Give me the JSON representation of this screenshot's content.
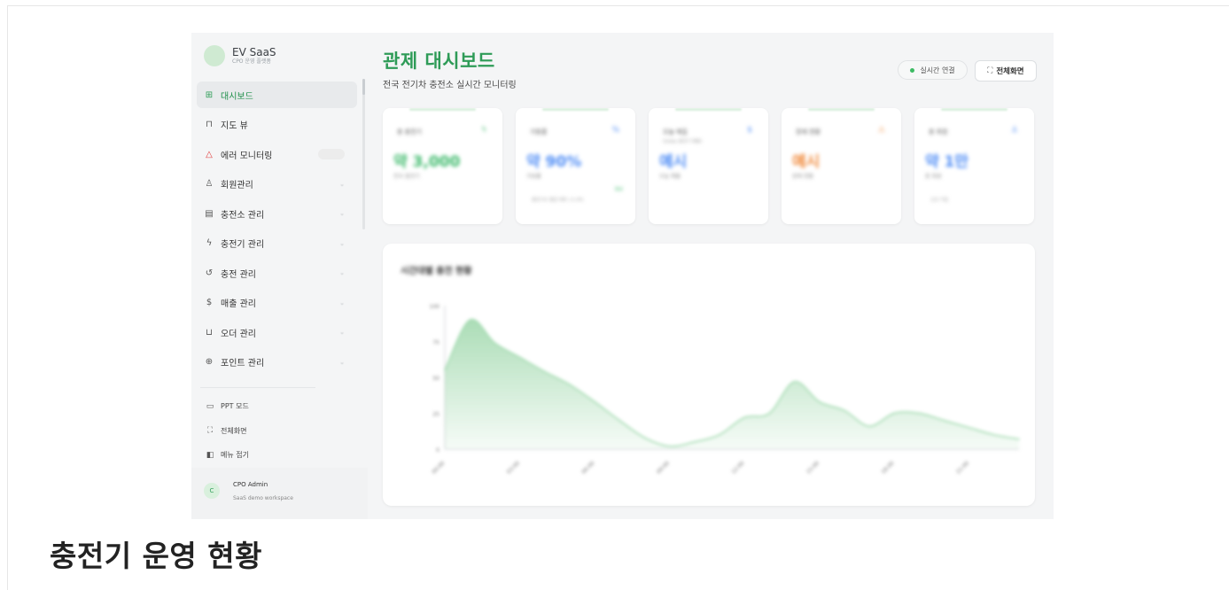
{
  "sidebar": {
    "brand_name": "EV SaaS",
    "brand_sub": "CPO 운영 플랫폼",
    "items": [
      {
        "label": "대시보드",
        "icon": "dashboard-icon",
        "glyph": "⊞",
        "active": true
      },
      {
        "label": "지도 뷰",
        "icon": "map-icon",
        "glyph": "⊓"
      },
      {
        "label": "에러 모니터링",
        "icon": "alert-triangle-icon",
        "glyph": "△"
      },
      {
        "label": "회원관리",
        "icon": "users-icon",
        "glyph": "♙"
      },
      {
        "label": "충전소 관리",
        "icon": "building-icon",
        "glyph": "▤"
      },
      {
        "label": "충전기 관리",
        "icon": "bolt-icon",
        "glyph": "ϟ"
      },
      {
        "label": "충전 관리",
        "icon": "history-icon",
        "glyph": "↺"
      },
      {
        "label": "매출 관리",
        "icon": "dollar-icon",
        "glyph": "$"
      },
      {
        "label": "오더 관리",
        "icon": "cart-icon",
        "glyph": "⊔"
      },
      {
        "label": "포인트 관리",
        "icon": "gift-icon",
        "glyph": "⊕"
      }
    ],
    "tools": [
      {
        "label": "PPT 모드",
        "icon": "presentation-icon",
        "glyph": "▭"
      },
      {
        "label": "전체화면",
        "icon": "fullscreen-icon",
        "glyph": "⛶"
      },
      {
        "label": "메뉴 접기",
        "icon": "collapse-menu-icon",
        "glyph": "◧"
      }
    ],
    "user": {
      "initial": "C",
      "name": "CPO Admin",
      "workspace": "SaaS demo workspace"
    }
  },
  "header": {
    "title": "관제 대시보드",
    "subtitle": "전국 전기차 충전소 실시간 모니터링",
    "live_label": "실시간 연결",
    "fullscreen_label": "전체화면"
  },
  "cards": [
    {
      "title": "총 충전기",
      "value": "약 3,000",
      "sub": "전국 충전기",
      "color": "#3cb96a",
      "icon": "bolt-icon",
      "glyph": "ϟ"
    },
    {
      "title": "가동률",
      "value": "약 90%",
      "sub": "가동률",
      "extra": "총전기수 평균 대비 +1.4%",
      "badge": "정상",
      "color": "#4e8cf5",
      "icon": "percent-icon",
      "glyph": "%"
    },
    {
      "title": "오늘 매출",
      "value": "예시",
      "sub": "오늘 매출",
      "sub2": "(today 총전기 매출)",
      "color": "#4e8cf5",
      "icon": "dollar-icon",
      "glyph": "$"
    },
    {
      "title": "장애 현황",
      "value": "예시",
      "sub": "장애 현황",
      "color": "#f08a3c",
      "icon": "warning-icon",
      "glyph": "⚠"
    },
    {
      "title": "총 회원",
      "value": "약 1만",
      "sub": "총 회원",
      "extra": "신규 가입",
      "color": "#4e8cf5",
      "icon": "users-icon",
      "glyph": "♙"
    }
  ],
  "chart_data": {
    "type": "area",
    "title": "시간대별 충전 현황",
    "yticks": [
      "100",
      "75",
      "50",
      "25",
      "0"
    ],
    "xticks": [
      "00:00",
      "03:00",
      "06:00",
      "09:00",
      "12:00",
      "15:00",
      "18:00",
      "21:00"
    ],
    "x": [
      0,
      1,
      2,
      3,
      4,
      5,
      6,
      7,
      8,
      9,
      10,
      11,
      12,
      13,
      14,
      15,
      16,
      17,
      18,
      19,
      20,
      21,
      22,
      23
    ],
    "y": [
      55,
      90,
      74,
      64,
      54,
      45,
      33,
      20,
      8,
      2,
      5,
      10,
      22,
      25,
      47,
      33,
      27,
      16,
      25,
      25,
      20,
      15,
      10,
      7
    ],
    "ylim": [
      0,
      100
    ],
    "color": "#8fd19e",
    "grid": false
  },
  "caption": "충전기 운영 현황"
}
